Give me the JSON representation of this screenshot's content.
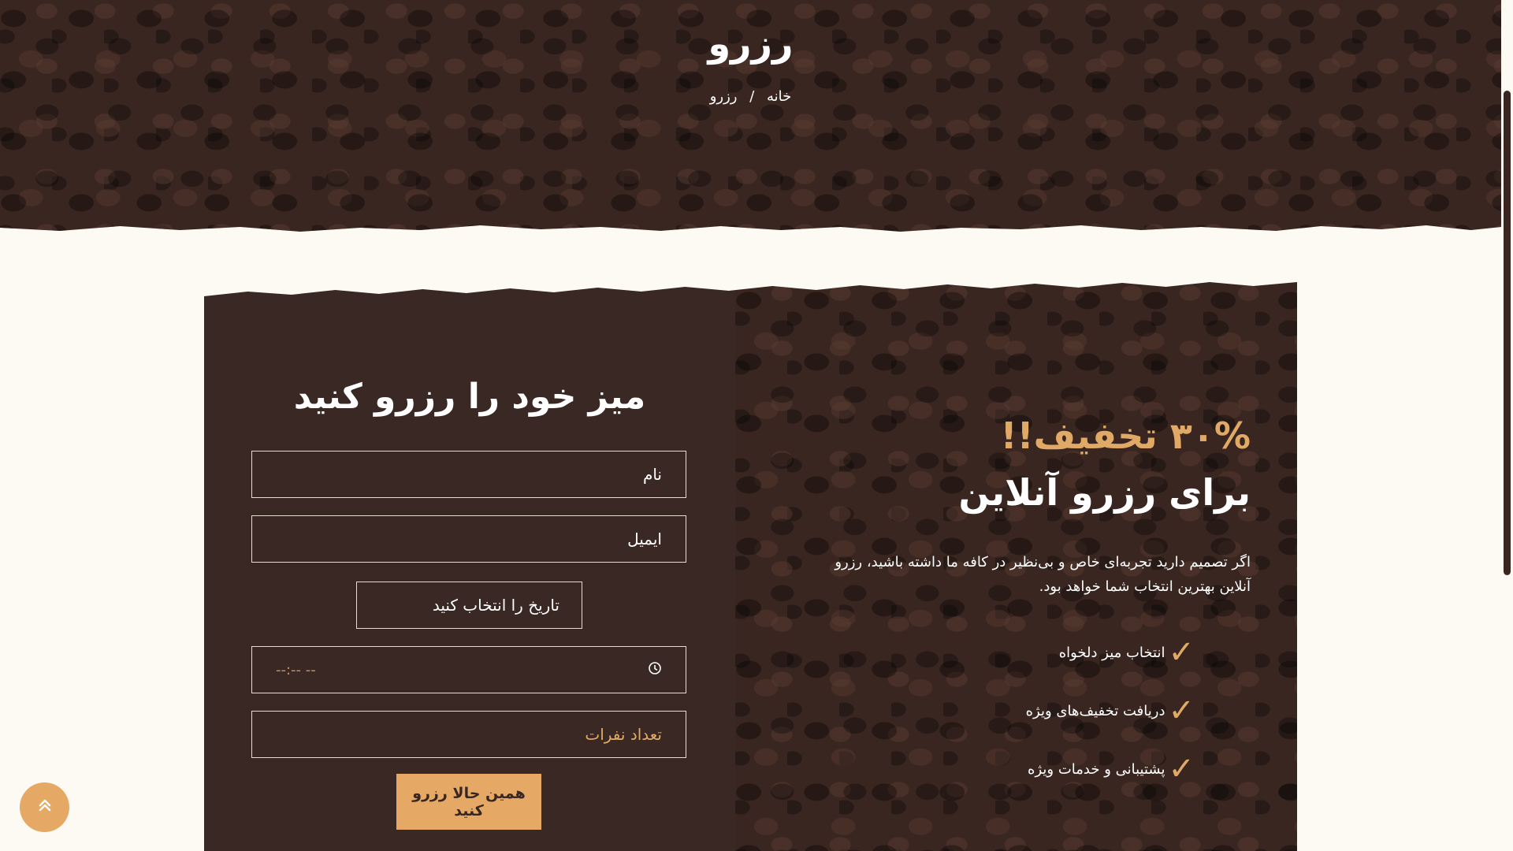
{
  "hero": {
    "title": "رزرو",
    "breadcrumb": {
      "home": "خانه",
      "separator": "/",
      "current": "رزرو"
    }
  },
  "form": {
    "title": "میز خود را رزرو کنید",
    "name_placeholder": "نام",
    "email_placeholder": "ایمیل",
    "date_placeholder": "تاریخ را انتخاب کنید",
    "time_value": "--:-- --",
    "time_icon": "clock-icon",
    "count_placeholder": "تعداد نفرات",
    "submit_label": "همین حالا رزرو کنید"
  },
  "promo": {
    "heading": "۳۰% تخفیف!!",
    "subheading": "برای رزرو آنلاین",
    "text": "اگر تصمیم دارید تجربه‌ای خاص و بی‌نظیر در کافه ما داشته باشید، رزرو آنلاین بهترین انتخاب شما خواهد بود.",
    "features": [
      "انتخاب میز دلخواه",
      "دریافت تخفیف‌های ویژه",
      "پشتیبانی و خدمات ویژه"
    ],
    "feature_icon": "checkmark-icon"
  },
  "scroll_top_icon": "double-chevron-up-icon",
  "colors": {
    "accent": "#e5a965",
    "dark": "#3a2621",
    "background": "#fdf9f3"
  }
}
